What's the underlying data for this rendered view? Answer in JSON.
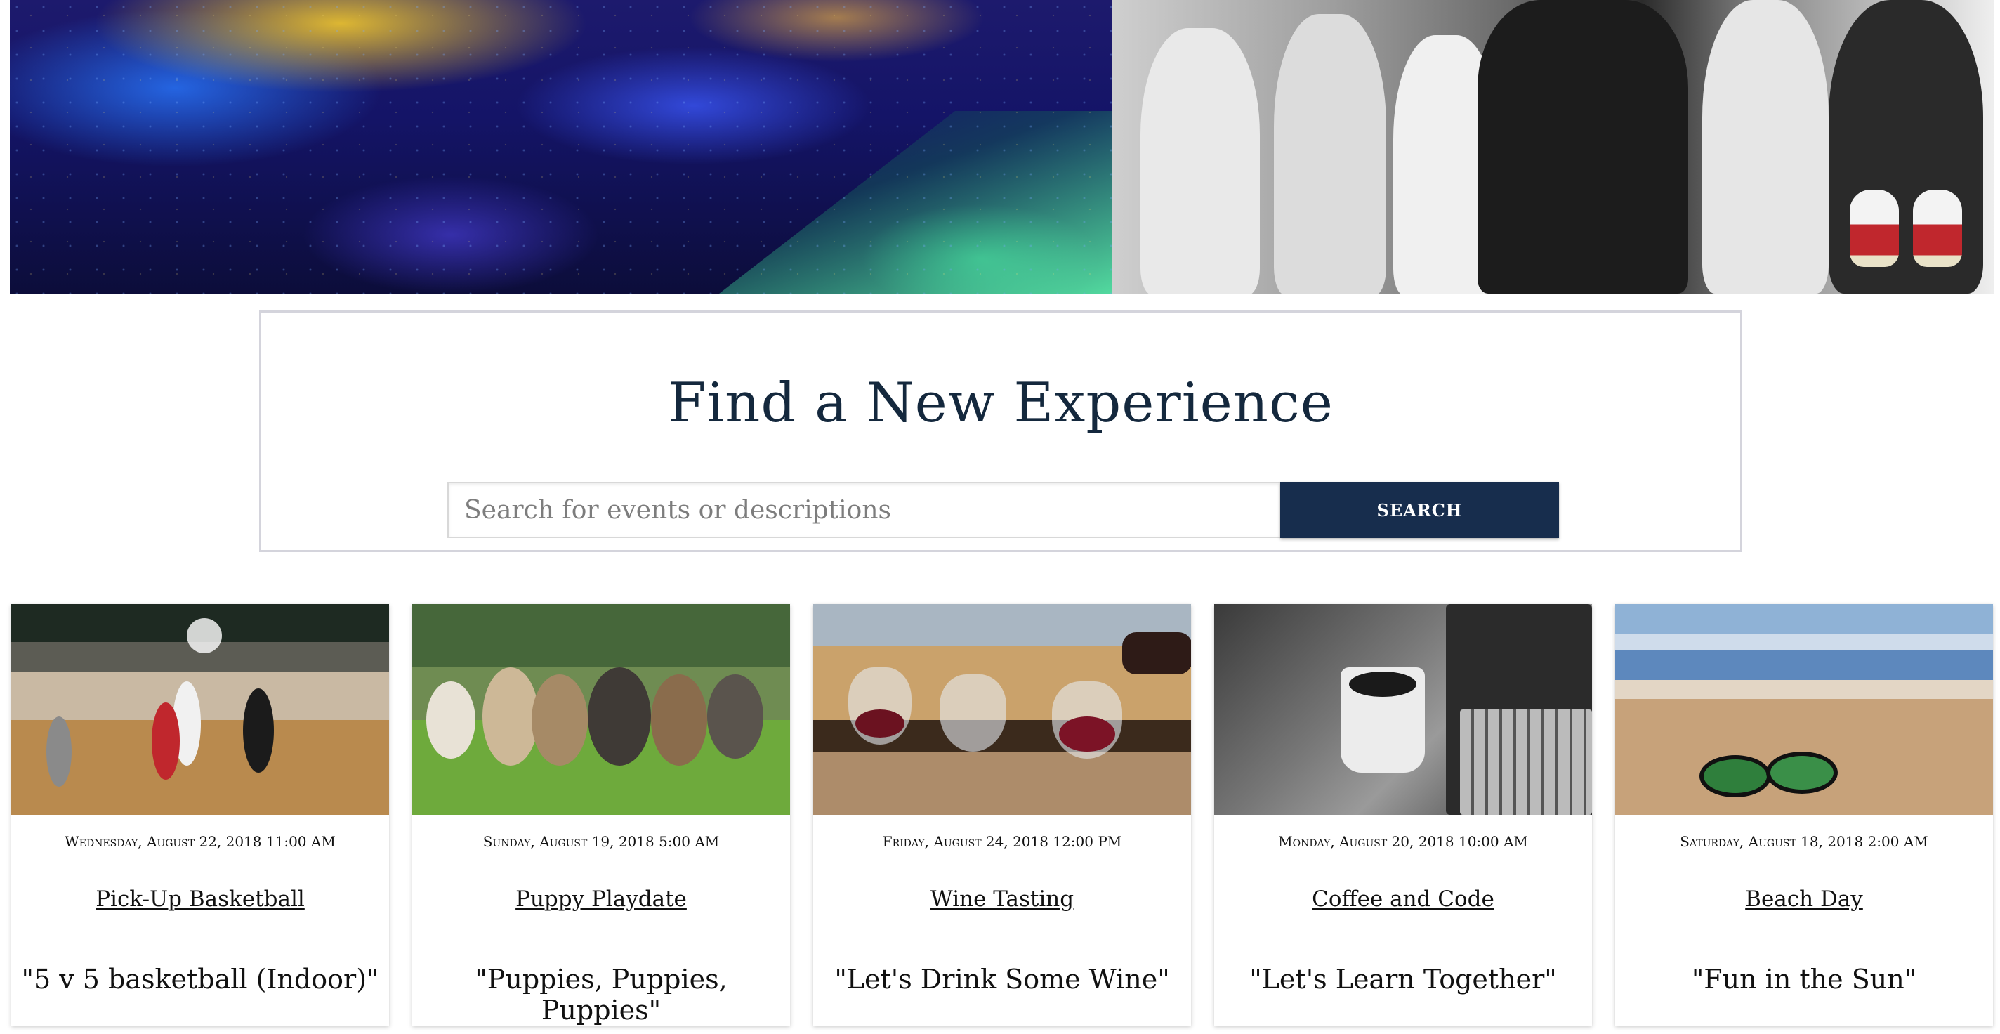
{
  "hero": {
    "left_image": "concert-crowd-image",
    "right_image": "basketball-game-image"
  },
  "search": {
    "title": "Find a New Experience",
    "placeholder": "Search for events or descriptions",
    "button_label": "SEARCH"
  },
  "events": [
    {
      "image": "basketball-court-image",
      "date": "Wednesday, August 22, 2018 11:00 AM",
      "title": "Pick-Up Basketball",
      "description": "\"5 v 5 basketball (Indoor)\""
    },
    {
      "image": "puppies-image",
      "date": "Sunday, August 19, 2018 5:00 AM",
      "title": "Puppy Playdate",
      "description": "\"Puppies, Puppies, Puppies\""
    },
    {
      "image": "wine-glasses-image",
      "date": "Friday, August 24, 2018 12:00 PM",
      "title": "Wine Tasting",
      "description": "\"Let's Drink Some Wine\""
    },
    {
      "image": "coffee-laptop-image",
      "date": "Monday, August 20, 2018 10:00 AM",
      "title": "Coffee and Code",
      "description": "\"Let's Learn Together\""
    },
    {
      "image": "beach-sunglasses-image",
      "date": "Saturday, August 18, 2018 2:00 AM",
      "title": "Beach Day",
      "description": "\"Fun in the Sun\""
    }
  ],
  "colors": {
    "title_text": "#14283d",
    "search_button_bg": "#172d4d",
    "panel_border": "#d4d4dc"
  }
}
